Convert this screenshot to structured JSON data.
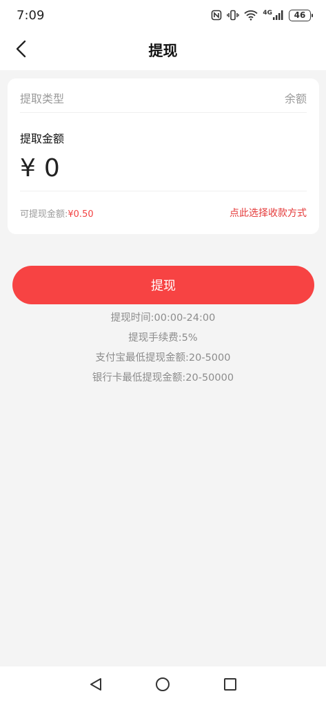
{
  "status_bar": {
    "time": "7:09",
    "network": "4G",
    "battery": "46"
  },
  "nav": {
    "title": "提现"
  },
  "form": {
    "type_label": "提取类型",
    "type_value": "余额",
    "amount_label": "提取金额",
    "currency_symbol": "¥",
    "amount_placeholder": "0",
    "available_label": "可提现金额:",
    "available_value": "¥0.50",
    "select_method_label": "点此选择收款方式"
  },
  "submit_label": "提现",
  "notes": [
    "提现时间:00:00-24:00",
    "提现手续费:5%",
    "支付宝最低提现金额:20-5000",
    "银行卡最低提现金额:20-50000"
  ],
  "colors": {
    "accent": "#f74343",
    "link": "#e43a3a",
    "background": "#f4f4f4"
  }
}
